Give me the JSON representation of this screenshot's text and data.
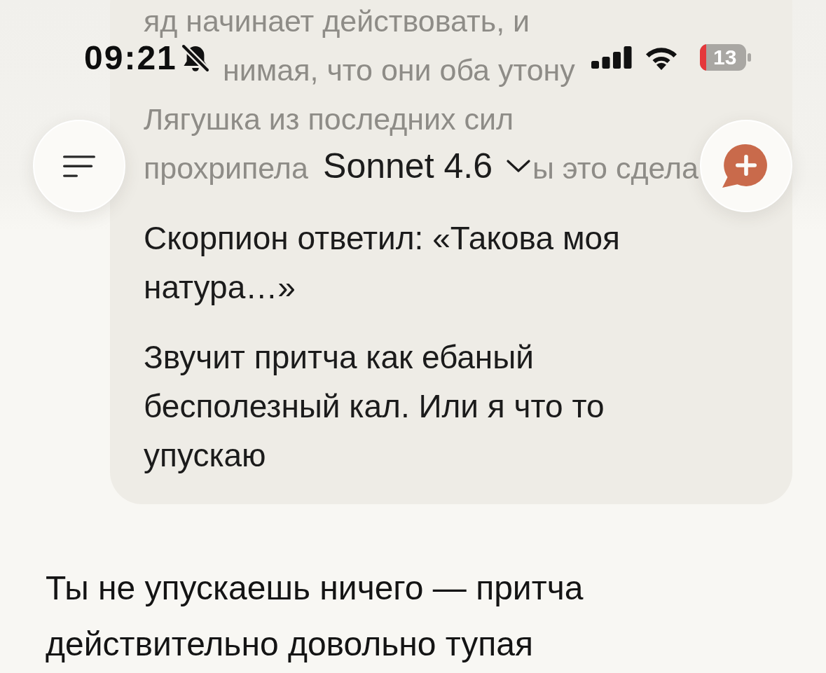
{
  "status_bar": {
    "time": "09:21",
    "battery": "13"
  },
  "header": {
    "model": "Sonnet 4.6"
  },
  "messages": [
    {
      "kind": "user",
      "faded_lines": [
        [
          "яд начинает действовать, и"
        ],
        [
          "нимая, что они оба утону"
        ],
        [
          "Лягушка из последних сил"
        ],
        [
          "прохрипела",
          "ы это сдела"
        ]
      ],
      "paragraphs": [
        "Скорпион ответил: «Такова моя натура…»",
        "Звучит притча как ебаный бесполезный кал. Или я что то упускаю"
      ]
    },
    {
      "kind": "assistant",
      "paragraphs": [
        "Ты не упускаешь ничего — притча действительно довольно тупая"
      ]
    }
  ]
}
